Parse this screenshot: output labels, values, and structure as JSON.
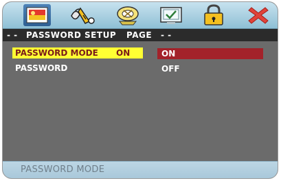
{
  "tabs": [
    {
      "icon": "general-setup-icon",
      "active": true
    },
    {
      "icon": "audio-setup-icon",
      "active": false
    },
    {
      "icon": "video-setup-icon",
      "active": false
    },
    {
      "icon": "preference-icon",
      "active": false
    },
    {
      "icon": "password-lock-icon",
      "active": false
    },
    {
      "icon": "exit-icon",
      "active": false
    }
  ],
  "header": {
    "left_dashes": "- -",
    "title": "PASSWORD SETUP",
    "page_label": "PAGE",
    "right_dashes": "- -"
  },
  "menu": {
    "items": [
      {
        "label": "PASSWORD MODE",
        "value": "ON",
        "selected": true
      },
      {
        "label": "PASSWORD",
        "value": "",
        "selected": false
      }
    ]
  },
  "options": [
    {
      "label": "ON",
      "selected": true
    },
    {
      "label": "OFF",
      "selected": false
    }
  ],
  "status": {
    "text": "PASSWORD MODE"
  },
  "colors": {
    "background": "#6b6b6b",
    "selected_item": "#ffff33",
    "selected_option": "#a3222a",
    "icon_bar": "#a9cfe0"
  }
}
